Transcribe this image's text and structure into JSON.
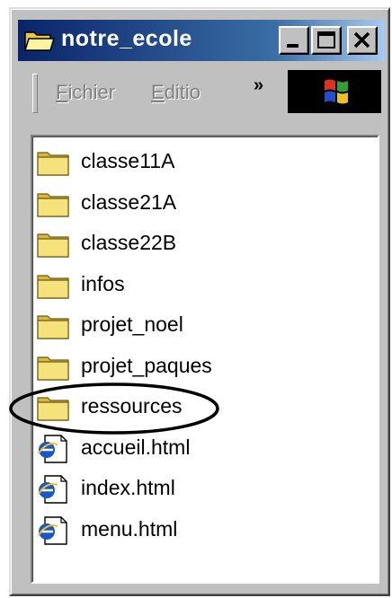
{
  "window": {
    "title": "notre_ecole",
    "title_icon": "folder-open-icon",
    "controls": [
      "minimize-icon",
      "maximize-icon",
      "close-icon"
    ]
  },
  "menu": {
    "fichier_label_first": "F",
    "fichier_label_rest": "ichier",
    "edition_label_first": "E",
    "edition_label_rest": "ditio",
    "overflow_label": "»",
    "logo_icon": "windows-logo-icon"
  },
  "files": [
    {
      "name": "classe11A",
      "icon": "folder-icon"
    },
    {
      "name": "classe21A",
      "icon": "folder-icon"
    },
    {
      "name": "classe22B",
      "icon": "folder-icon"
    },
    {
      "name": "infos",
      "icon": "folder-icon"
    },
    {
      "name": "projet_noel",
      "icon": "folder-icon"
    },
    {
      "name": "projet_paques",
      "icon": "folder-icon"
    },
    {
      "name": "ressources",
      "icon": "folder-icon",
      "highlighted": true
    },
    {
      "name": "accueil.html",
      "icon": "html-file-icon"
    },
    {
      "name": "index.html",
      "icon": "html-file-icon"
    },
    {
      "name": "menu.html",
      "icon": "html-file-icon"
    }
  ],
  "colors": {
    "title_bar": "#0a246a",
    "face": "#c0c0c0",
    "folder": "#f5e27a",
    "ellipse": "#000000"
  }
}
